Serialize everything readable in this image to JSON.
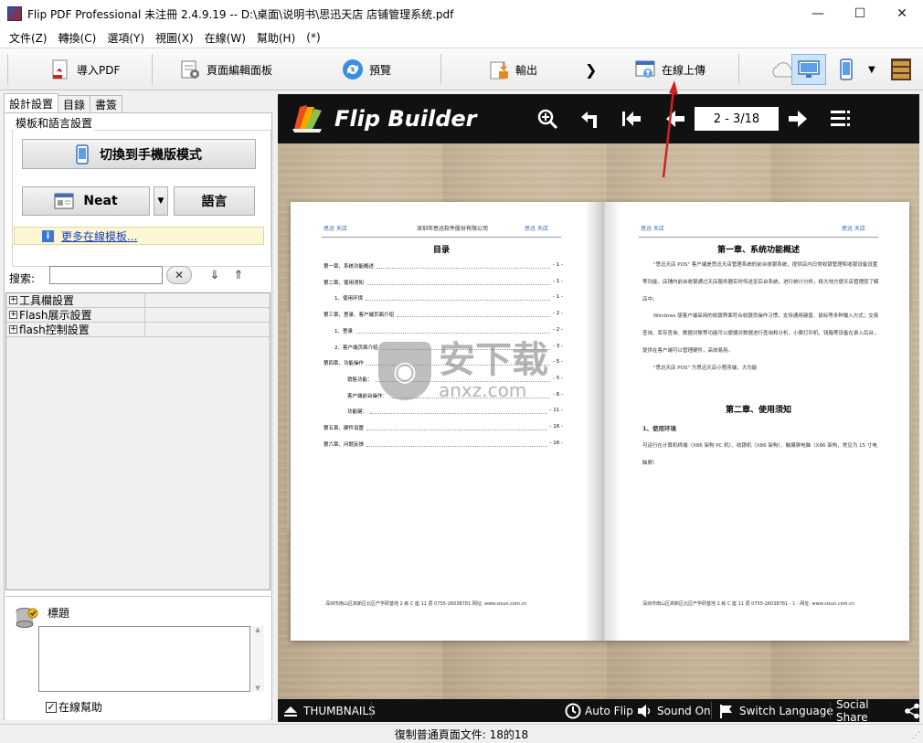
{
  "window": {
    "title": "Flip PDF Professional 未注冊 2.4.9.19 -- D:\\桌面\\说明书\\思迅天店 店铺管理系统.pdf",
    "minimize": "—",
    "maximize": "☐",
    "close": "✕"
  },
  "menu": [
    "文件(Z)",
    "轉換(C)",
    "選項(Y)",
    "視圖(X)",
    "在線(W)",
    "幫助(H)",
    "(*)"
  ],
  "toolbar": {
    "import_pdf": "導入PDF",
    "page_editor": "頁面編輯面板",
    "preview": "預覽",
    "output": "輸出",
    "next": "❯",
    "upload": "在線上傳"
  },
  "left": {
    "tabs": [
      "設計設置",
      "目錄",
      "書簽"
    ],
    "group_label": "模板和語言設置",
    "switch_mobile": "切換到手機版模式",
    "template_name": "Neat",
    "language": "語言",
    "more_templates": "更多在線模板...",
    "search_label": "搜索:",
    "search_value": "",
    "tree": [
      "工具欄設置",
      "Flash展示設置",
      "flash控制設置"
    ],
    "prop_label": "標題",
    "help_label": "在線幫助",
    "help_checked": true
  },
  "preview": {
    "brand": "Flip Builder",
    "page_indicator": "2 - 3/18",
    "bottom": {
      "thumbnails": "THUMBNAILS",
      "auto_flip": "Auto Flip",
      "sound": "Sound On",
      "language": "Switch Language",
      "share": "Social Share"
    },
    "left_page": {
      "header_left": "思迅 天店",
      "header_mid": "深圳市思迅软件股份有限公司",
      "header_right": "思迅 天店",
      "title": "目录",
      "toc": [
        {
          "t": "第一章、系统功能概述",
          "p": "- 1 -"
        },
        {
          "t": "第二章、使用须知",
          "p": "- 1 -"
        },
        {
          "t": "1、使用环境",
          "p": "- 1 -"
        },
        {
          "t": "第三章、登录、客户端页面介绍",
          "p": "- 2 -"
        },
        {
          "t": "1、登录",
          "p": "- 2 -"
        },
        {
          "t": "2、客户端页面介绍",
          "p": "- 3 -"
        },
        {
          "t": "第四章、功能操作",
          "p": "- 5 -"
        },
        {
          "t": "销售功能：",
          "p": "- 5 -"
        },
        {
          "t": "客户端前台操作：",
          "p": "- 6 -"
        },
        {
          "t": "功能键：",
          "p": "- 11 -"
        },
        {
          "t": "第五章、硬件设置",
          "p": "- 16 -"
        },
        {
          "t": "第六章、问题反馈",
          "p": "- 16 -"
        }
      ],
      "footer": "深圳市南山区高新区北区产学研基地 2 栋 C 座 11 层 0755-26038781    网址: www.sixun.com.cn"
    },
    "right_page": {
      "header_left": "思迅 天店",
      "header_right": "思迅 天店",
      "ch1": "第一章、系统功能概述",
      "p1": "\"思迅天店 POS\" 客户端是思迅天店管理系统的前台收银系统，提供店内日常收银管理和收银设备设置等功能，店铺内前台收银通过天店服务器实时传送至后台系统，进行统计分析，极大地方便天店管理层了解店中。",
      "p2": "Windows 版客户端采用的收银界面符合收银员操作习惯，支持通用键盘、鼠标等多种输入方式；交易查询、库存查询、数据对账等功能可以便捷对数据进行查询和分析，小票打印机、钱箱等设备在录入后台，提供在客户端可以管理硬件，高效易用。",
      "p3": "\"思迅天店 POS\" 为思迅天店小程序端，大功能",
      "ch2": "第二章、使用须知",
      "sub": "1、使用环境",
      "p4": "可运行在计算机终端（X86 架构 PC 机）、收银机（X86 架构）、触摸屏电脑（X86 架构，常见为 15 寸电脑屏）",
      "footer": "深圳市南山区高新区北区产学研基地 2 栋 C 座 11 层 0755-26038781    - 1 -    网址: www.sixun.com.cn"
    },
    "watermark": "安下载",
    "watermark_sub": "anxz.com"
  },
  "status": "復制普通頁面文件: 18的18",
  "colors": {
    "accent_red": "#d42020",
    "preview_bar": "#111111"
  }
}
